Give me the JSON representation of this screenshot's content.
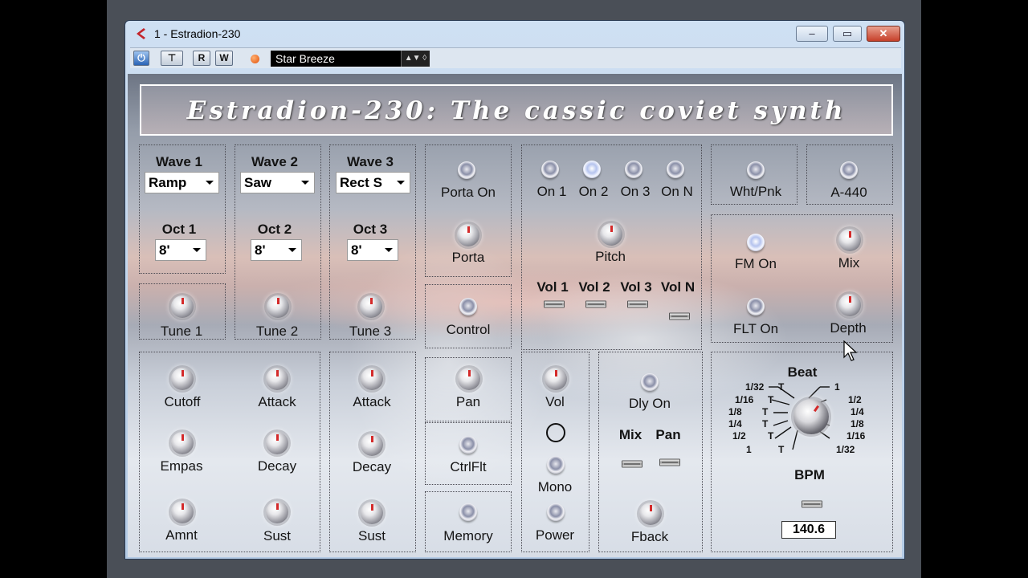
{
  "window": {
    "title": "1 - Estradion-230",
    "controls": [
      "minimize",
      "maximize",
      "close"
    ]
  },
  "toolbar": {
    "power_label": "⏻",
    "bypass_label": "⊤",
    "read_label": "R",
    "write_label": "W",
    "preset_name": "Star Breeze",
    "preset_arrows": "▲▼ ◊"
  },
  "plugin": {
    "banner_title": "Estradion-230: The cassic coviet synth",
    "osc1": {
      "wave_label": "Wave 1",
      "wave_value": "Ramp",
      "oct_label": "Oct 1",
      "oct_value": "8'",
      "tune_label": "Tune 1"
    },
    "osc2": {
      "wave_label": "Wave 2",
      "wave_value": "Saw",
      "oct_label": "Oct 2",
      "oct_value": "8'",
      "tune_label": "Tune 2"
    },
    "osc3": {
      "wave_label": "Wave 3",
      "wave_value": "Rect S",
      "oct_label": "Oct 3",
      "oct_value": "8'",
      "tune_label": "Tune 3"
    },
    "porta": {
      "on_label": "Porta On",
      "knob_label": "Porta"
    },
    "control_label": "Control",
    "filter": {
      "cutoff": "Cutoff",
      "attack": "Attack",
      "empas": "Empas",
      "decay": "Decay",
      "amnt": "Amnt",
      "sust": "Sust"
    },
    "env3": {
      "attack": "Attack",
      "decay": "Decay",
      "sust": "Sust"
    },
    "pan_label": "Pan",
    "ctrlflt_label": "CtrlFlt",
    "memory_label": "Memory",
    "switches": {
      "on1": "On 1",
      "on2": "On 2",
      "on3": "On 3",
      "onN": "On N"
    },
    "pitch_label": "Pitch",
    "vols": {
      "v1": "Vol 1",
      "v2": "Vol 2",
      "v3": "Vol 3",
      "vN": "Vol N"
    },
    "vol_label": "Vol",
    "mono_label": "Mono",
    "power_label": "Power",
    "delay": {
      "on_label": "Dly On",
      "mix_label": "Mix",
      "pan_label": "Pan",
      "fback_label": "Fback"
    },
    "noise_label": "Wht/Pnk",
    "a440_label": "A-440",
    "fm": {
      "on_label": "FM On",
      "mix_label": "Mix",
      "flt_label": "FLT On",
      "depth_label": "Depth"
    },
    "beat": {
      "title": "Beat",
      "left": [
        "1/32",
        "1/16",
        "1/8",
        "1/4",
        "1/2",
        "1"
      ],
      "left_t": [
        "T",
        "T",
        "T",
        "T",
        "T",
        "T"
      ],
      "right": [
        "1",
        "1/2",
        "1/4",
        "1/8",
        "1/16",
        "1/32"
      ],
      "bpm_label": "BPM",
      "bpm_value": "140.6"
    }
  }
}
